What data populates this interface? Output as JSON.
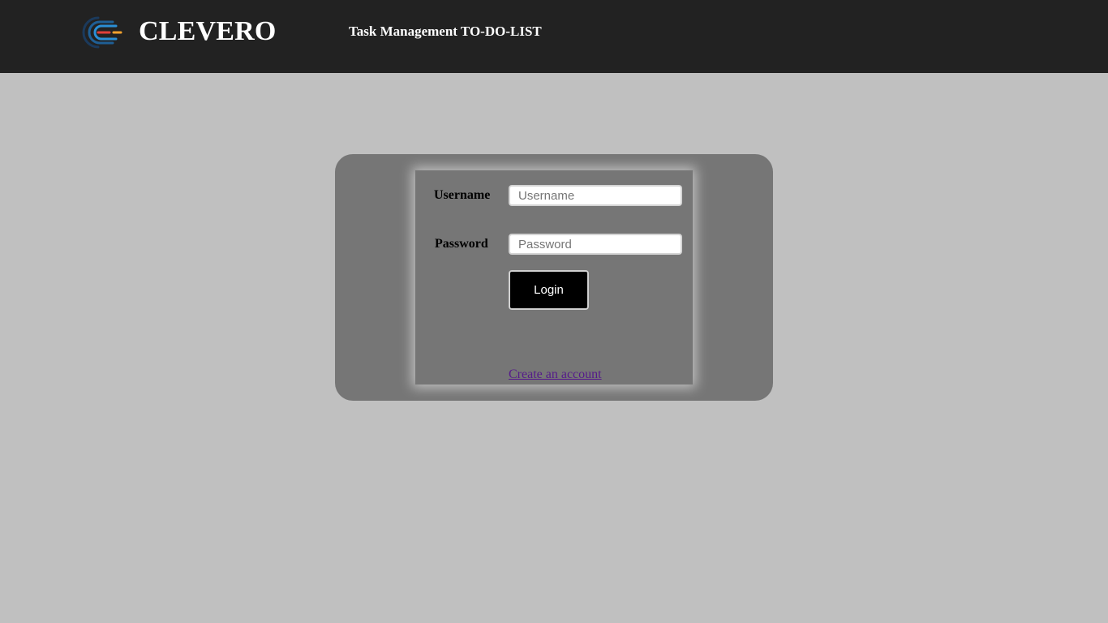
{
  "header": {
    "brand": "CLEVERO",
    "tagline": "Task Management TO-DO-LIST",
    "logo_icon": "clevero-logo-icon",
    "background": "#222222"
  },
  "login": {
    "username_label": "Username",
    "username_placeholder": "Username",
    "username_value": "",
    "password_label": "Password",
    "password_placeholder": "Password",
    "password_value": "",
    "login_button": "Login",
    "create_account_link": "Create an account"
  },
  "colors": {
    "page_background": "#c0c0c0",
    "panel": "#767676",
    "button": "#000000",
    "link": "#551a8b"
  }
}
